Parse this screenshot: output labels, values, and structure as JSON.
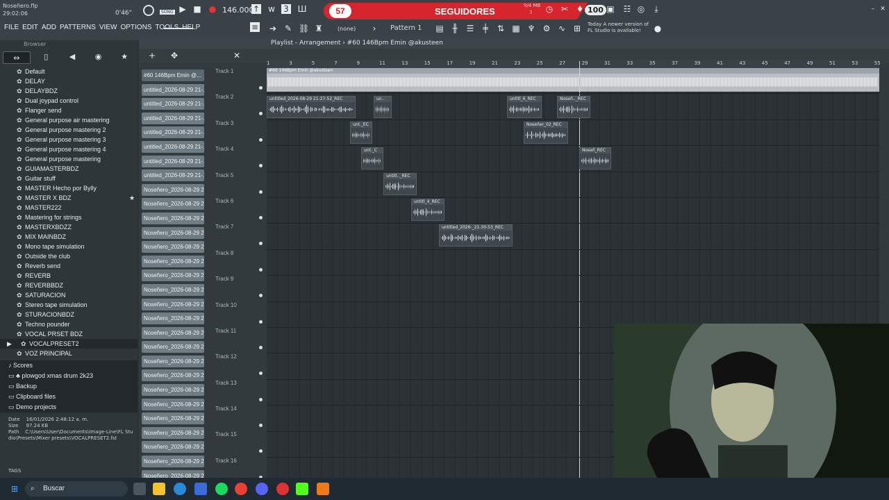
{
  "window": {
    "file": "Noseñero.flp",
    "time": "29:02:06",
    "mini_time": "0'46\"",
    "bpm": "146.000",
    "pattern": "Pattern 1",
    "none_label": "(none)",
    "cpu": "9/4 MB",
    "cpu2": "3",
    "notice": "Today  A newer version of FL Studio is available!",
    "volume": "100"
  },
  "menu": [
    "FILE",
    "EDIT",
    "ADD",
    "PATTERNS",
    "VIEW",
    "OPTIONS",
    "TOOLS",
    "HELP"
  ],
  "banner": {
    "count": "57",
    "label": "SEGUIDORES"
  },
  "browser": {
    "title": "Browser",
    "items": [
      "Default",
      "DELAY",
      "DELAYBDZ",
      "Dual joypad control",
      "Flanger send",
      "General purpose air mastering",
      "General purpose mastering 2",
      "General purpose mastering 3",
      "General purpose mastering 4",
      "General purpose mastering",
      "GUIAMASTERBDZ",
      "Guitar stuff",
      "MASTER Hecho por Bylly",
      "MASTER X BDZ",
      "MASTER222",
      "Mastering for strings",
      "MASTERXBDZZ",
      "MIX MAINBDZ",
      "Mono tape simulation",
      "Outside the club",
      "Reverb send",
      "REVERB",
      "REVERBBDZ",
      "SATURACION",
      "Stereo tape simulation",
      "STURACIONBDZ",
      "Techno pounder",
      "VOCAL PRSET BDZ",
      "VOCALPRESET2",
      "VOZ PRINCIPAL"
    ],
    "sections": [
      "Scores",
      "plowgod xmas drum 2k23",
      "Backup",
      "Clipboard files",
      "Demo projects"
    ],
    "info": {
      "date_label": "Date",
      "date": "16/01/2026 2:48:12 a. m.",
      "size_label": "Size",
      "size": "97.24 KB",
      "path_label": "Path",
      "path": "C:\\Users\\User\\Documents\\Image-Line\\FL Studio\\Presets\\Mixer presets\\VOCALPRESET2.fst"
    },
    "tags": "TAGS"
  },
  "playlist": {
    "title": "Playlist - Arrangement › #60 146Bpm Emin @akusteen",
    "clips": [
      "#60 146Bpm Emin @...",
      "untitled_2026-08-29 21-...",
      "untitled_2026-08-29 21-...",
      "untitled_2026-08-29 21-...",
      "untitled_2026-08-29 21-...",
      "untitled_2026-08-29 21-...",
      "untitled_2026-08-29 21-...",
      "untitled_2026-08-29 21-...",
      "Noseñero_2026-08-29 2...",
      "Noseñero_2026-08-29 2...",
      "Noseñero_2026-08-29 2...",
      "Noseñero_2026-08-29 2...",
      "Noseñero_2026-08-29 2...",
      "Noseñero_2026-08-29 2...",
      "Noseñero_2026-08-29 2...",
      "Noseñero_2026-08-29 2...",
      "Noseñero_2026-08-29 2...",
      "Noseñero_2026-08-29 2...",
      "Noseñero_2026-08-29 2...",
      "Noseñero_2026-08-29 2...",
      "Noseñero_2026-08-29 2...",
      "Noseñero_2026-08-29 2...",
      "Noseñero_2026-08-29 2...",
      "Noseñero_2026-08-29 2...",
      "Noseñero_2026-08-29 2...",
      "Noseñero_2026-08-29 2...",
      "Noseñero_2026-08-29 2...",
      "Noseñero_2026-08-29 2...",
      "Noseñero_2026-08-29 2...",
      "Noseñero_2026-08-29 2..."
    ],
    "tracks": [
      "Track 1",
      "Track 2",
      "Track 3",
      "Track 4",
      "Track 5",
      "Track 6",
      "Track 7",
      "Track 8",
      "Track 9",
      "Track 10",
      "Track 11",
      "Track 12",
      "Track 13",
      "Track 14",
      "Track 15",
      "Track 16"
    ],
    "ruler": [
      "1",
      "3",
      "5",
      "7",
      "9",
      "11",
      "13",
      "15",
      "17",
      "19",
      "21",
      "23",
      "25",
      "27",
      "29",
      "31",
      "33",
      "35",
      "37",
      "39",
      "41",
      "43",
      "45",
      "47",
      "49",
      "51",
      "53",
      "55"
    ],
    "arr_clips": [
      {
        "label": "#60 146Bpm Emin @akusteen"
      },
      {
        "label": "untitled_2026-08-29 21-27-52_REC"
      },
      {
        "label": "un.."
      },
      {
        "label": "untitl_6_REC"
      },
      {
        "label": "Noseñ.._REC"
      },
      {
        "label": "unt._EC"
      },
      {
        "label": "Noseñer_02_REC"
      },
      {
        "label": "unt._C"
      },
      {
        "label": "Noseñ_REC"
      },
      {
        "label": "untitl.._REC"
      },
      {
        "label": "untitl_4_REC"
      },
      {
        "label": "untitled_2026-_21-30-53_REC"
      }
    ]
  },
  "taskbar": {
    "search": "Buscar"
  }
}
